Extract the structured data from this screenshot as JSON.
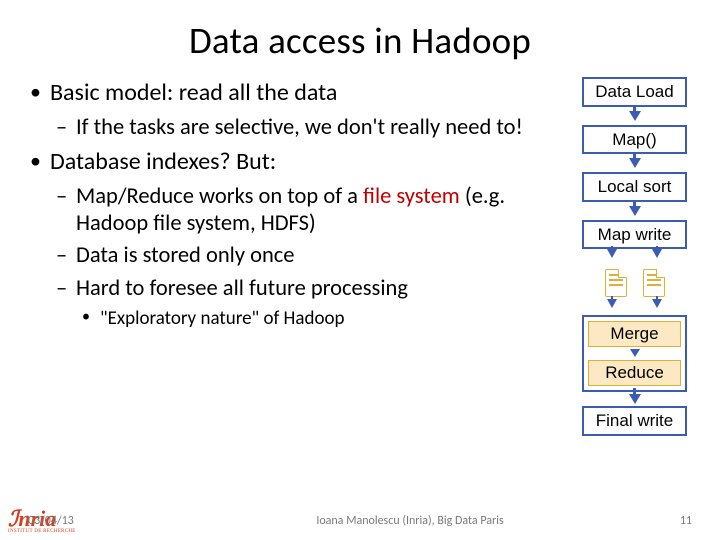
{
  "title": "Data access in Hadoop",
  "bullets": {
    "b1": "Basic model: read all the data",
    "b1a": "If the tasks are selective, we don't really need to!",
    "b2": "Database indexes? But:",
    "b2a_pre": "Map/Reduce works on top of a ",
    "b2a_red": "file system",
    "b2a_post": " (e.g. Hadoop file system, HDFS)",
    "b2b": "Data is stored only once",
    "b2c": "Hard to foresee all future processing",
    "b2c_i": "\"Exploratory nature\" of Hadoop"
  },
  "diagram": {
    "s1": "Data Load",
    "s2": "Map()",
    "s3": "Local sort",
    "s4": "Map write",
    "s5": "Merge",
    "s6": "Reduce",
    "s7": "Final write"
  },
  "footer": {
    "date": "03/04/13",
    "center": "Ioana Manolescu (Inria), Big Data Paris",
    "page": "11",
    "logo": "Inria"
  }
}
